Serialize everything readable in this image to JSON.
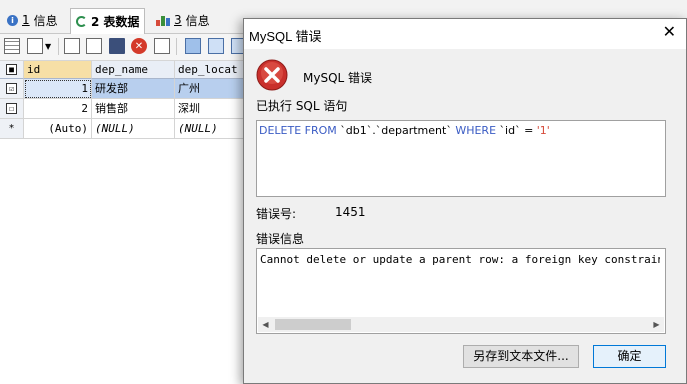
{
  "tabs": [
    {
      "num": "1",
      "label": "信息",
      "icon": "info-icon"
    },
    {
      "num": "2",
      "label": "表数据",
      "icon": "refresh-icon"
    },
    {
      "num": "3",
      "label": "信息",
      "icon": "bar-chart-icon"
    }
  ],
  "grid": {
    "columns": [
      "id",
      "dep_name",
      "dep_locat"
    ],
    "rows": [
      {
        "marker": "☑",
        "id": "1",
        "dep_name": "研发部",
        "dep_location": "广州"
      },
      {
        "marker": "☐",
        "id": "2",
        "dep_name": "销售部",
        "dep_location": "深圳"
      },
      {
        "marker": "*",
        "id": "(Auto)",
        "dep_name": "(NULL)",
        "dep_location": "(NULL)"
      }
    ]
  },
  "dialog": {
    "title": "MySQL 错误",
    "close_label": "✕",
    "heading": "MySQL 错误",
    "executed_label": "已执行 SQL 语句",
    "sql": {
      "kw1": "DELETE FROM",
      "part1": " `db1`.`department` ",
      "kw2": "WHERE",
      "part2": " `id` = ",
      "value": "'1'"
    },
    "errno_label": "错误号:",
    "errno_value": "1451",
    "errinfo_label": "错误信息",
    "errinfo_text": "Cannot delete or update a parent row: a foreign key constraint fails (`d",
    "save_button": "另存到文本文件...",
    "ok_button": "确定"
  },
  "colors": {
    "accent": "#0078d7",
    "error_red": "#d43a2a",
    "sql_keyword": "#3b5cc4",
    "sql_string": "#d64a3a"
  }
}
